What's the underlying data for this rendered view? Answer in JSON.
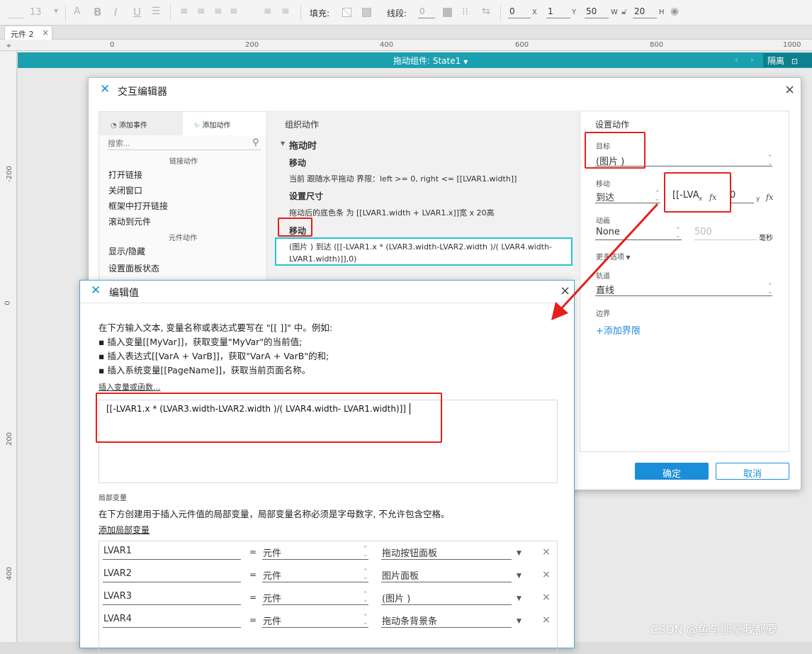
{
  "toolbar": {
    "font_size": "13",
    "fill_label": "填充:",
    "stroke_label": "线段:",
    "stroke_value": "0",
    "x_value": "0",
    "x_unit": "X",
    "y_value": "1",
    "y_unit": "Y",
    "w_value": "50",
    "w_unit": "W",
    "h_value": "20",
    "h_unit": "H"
  },
  "tab": {
    "label": "元件 2"
  },
  "ruler": {
    "h": [
      "0",
      "200",
      "400",
      "600",
      "800",
      "1000"
    ],
    "v": [
      "-200",
      "0",
      "200",
      "400"
    ]
  },
  "state_bar": {
    "label": "拖动组件: State1",
    "hide_label": "隔离"
  },
  "interaction_editor": {
    "title": "交互编辑器",
    "tab_add_event": "添加事件",
    "tab_add_action": "添加动作",
    "search_placeholder": "搜索...",
    "link_section": "链接动作",
    "link_actions": [
      "打开链接",
      "关闭窗口",
      "框架中打开链接",
      "滚动到元件"
    ],
    "widget_section": "元件动作",
    "widget_actions": [
      "显示/隐藏",
      "设置面板状态"
    ],
    "organize_title": "组织动作",
    "event_name": "拖动时",
    "action1_title": "移动",
    "action1_desc": "当前 跟随水平拖动 界限：left >= 0, right <= [[LVAR1.width]]",
    "action2_title": "设置尺寸",
    "action2_desc": "拖动后的底色条 为 [[LVAR1.width + LVAR1.x]]宽 x 20高",
    "action3_title": "移动",
    "action3_desc": "(图片 ) 到达 ([[-LVAR1.x * (LVAR3.width-LVAR2.width )/( LVAR4.width-LVAR1.width)]],0)",
    "settings_title": "设置动作",
    "target_label": "目标",
    "target_value": "(图片 )",
    "move_label": "移动",
    "move_type": "到达",
    "x_expr": "[[-LVA",
    "x_sub": "x",
    "fx_icon": "fx",
    "y_value": "0",
    "y_sub": "y",
    "anim_label": "动画",
    "anim_value": "None",
    "duration": "500",
    "ms_label": "毫秒",
    "more_options": "更多选项",
    "track_label": "轨道",
    "track_value": "直线",
    "bounds_label": "边界",
    "add_bounds": "+添加界限",
    "ok_label": "确定",
    "cancel_label": "取消"
  },
  "edit_value": {
    "title": "编辑值",
    "intro": "在下方输入文本, 变量名称或表达式要写在 \"[[ ]]\" 中。例如:",
    "bullet1": "▪ 插入变量[[MyVar]]，获取变量\"MyVar\"的当前值;",
    "bullet2": "▪ 插入表达式[[VarA + VarB]]，获取\"VarA + VarB\"的和;",
    "bullet3": "▪ 插入系统变量[[PageName]]，获取当前页面名称。",
    "insert_link": "插入变量或函数...",
    "expression": "[[-LVAR1.x * (LVAR3.width-LVAR2.width )/( LVAR4.width- LVAR1.width)]]",
    "local_title": "局部变量",
    "local_desc": "在下方创建用于插入元件值的局部变量，局部变量名称必须是字母数字, 不允许包含空格。",
    "add_local": "添加局部变量",
    "vars": [
      {
        "name": "LVAR1",
        "eq": "=",
        "type": "元件",
        "target": "拖动按钮面板"
      },
      {
        "name": "LVAR2",
        "eq": "=",
        "type": "元件",
        "target": "图片面板"
      },
      {
        "name": "LVAR3",
        "eq": "=",
        "type": "元件",
        "target": "(图片 )"
      },
      {
        "name": "LVAR4",
        "eq": "=",
        "type": "元件",
        "target": "拖动条背景条"
      }
    ]
  },
  "watermark": "CSDN @鱼与熊掌我都要",
  "colors": {
    "accent": "#1b8ed9",
    "teal": "#1ba0b0",
    "highlight_red": "#e3201b",
    "cyan_border": "#22c4d4"
  }
}
